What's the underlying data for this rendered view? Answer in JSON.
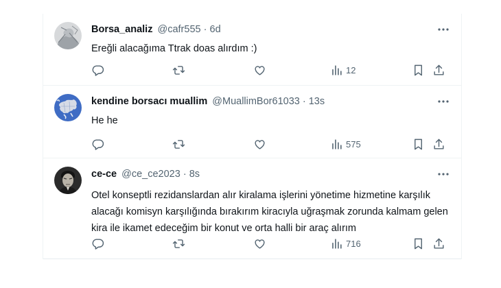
{
  "tweets": [
    {
      "name": "Borsa_analiz",
      "handle": "@cafr555",
      "separator": "·",
      "time": "6d",
      "text": "Ereğli alacağıma Ttrak doas alırdım :)",
      "views": "12",
      "avatar_icon": "sketch-avatar"
    },
    {
      "name": "kendine borsacı muallim",
      "handle": "@MuallimBor61033",
      "separator": "·",
      "time": "13s",
      "text": "He he",
      "views": "575",
      "avatar_icon": "europe-map-avatar"
    },
    {
      "name": "ce-ce",
      "handle": "@ce_ce2023",
      "separator": "·",
      "time": "8s",
      "text": "Otel konseptli rezidanslardan alır kiralama işlerini yönetime hizmetine karşılık alacağı komisyn karşılığında bırakırım kiracıyla uğraşmak zorunda kalmam gelen kira ile ikamet edeceğim bir konut ve orta halli bir araç alırım",
      "views": "716",
      "avatar_icon": "portrait-avatar"
    }
  ],
  "icons": {
    "reply": "reply-icon",
    "retweet": "retweet-icon",
    "like": "heart-icon",
    "views": "views-icon",
    "bookmark": "bookmark-icon",
    "share": "share-icon",
    "more": "more-icon"
  },
  "colors": {
    "text": "#0f1419",
    "secondary": "#536471",
    "border": "#eff3f4"
  }
}
